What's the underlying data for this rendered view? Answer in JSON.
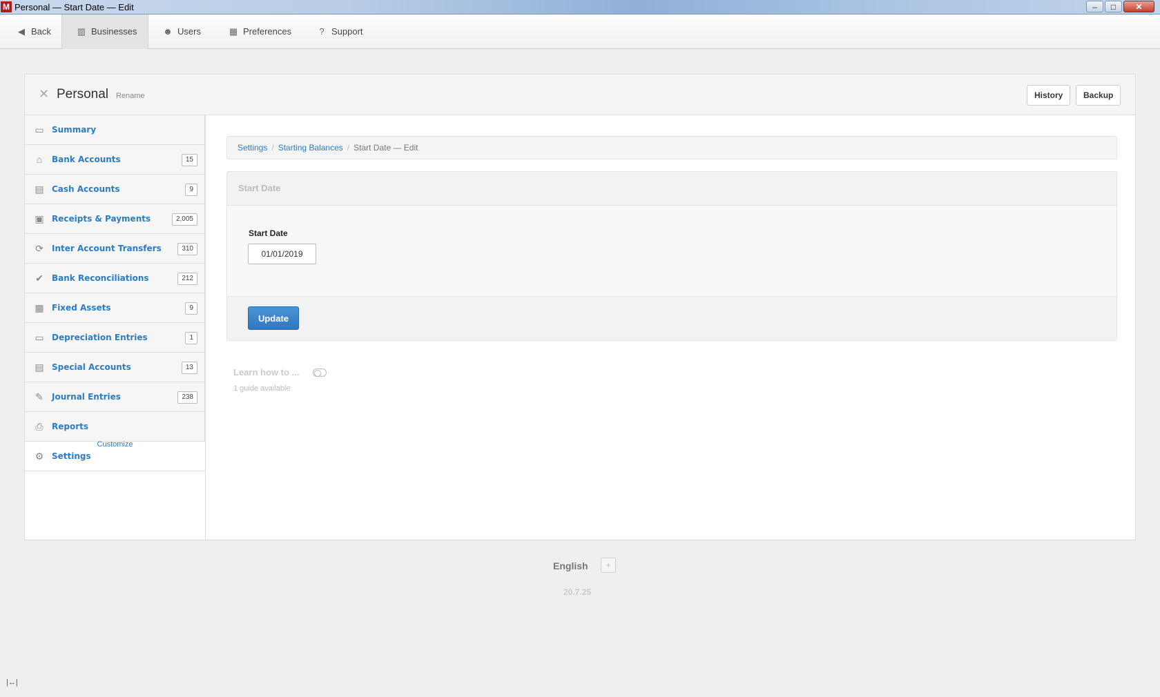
{
  "window": {
    "app_icon": "M",
    "title": "Personal — Start Date — Edit",
    "minimize": "–",
    "maximize": "□",
    "close": "✕"
  },
  "topnav": {
    "back": "Back",
    "businesses": "Businesses",
    "users": "Users",
    "preferences": "Preferences",
    "support": "Support"
  },
  "business": {
    "close": "✕",
    "name": "Personal",
    "rename": "Rename",
    "history": "History",
    "backup": "Backup"
  },
  "sidebar": {
    "items": [
      {
        "label": "Summary",
        "icon": "presentation-icon",
        "count": null
      },
      {
        "label": "Bank Accounts",
        "icon": "bank-icon",
        "count": "15"
      },
      {
        "label": "Cash Accounts",
        "icon": "cash-register-icon",
        "count": "9"
      },
      {
        "label": "Receipts & Payments",
        "icon": "receipt-icon",
        "count": "2,005"
      },
      {
        "label": "Inter Account Transfers",
        "icon": "transfer-icon",
        "count": "310"
      },
      {
        "label": "Bank Reconciliations",
        "icon": "checkmark-icon",
        "count": "212"
      },
      {
        "label": "Fixed Assets",
        "icon": "building-icon",
        "count": "9"
      },
      {
        "label": "Depreciation Entries",
        "icon": "battery-icon",
        "count": "1"
      },
      {
        "label": "Special Accounts",
        "icon": "book-icon",
        "count": "13"
      },
      {
        "label": "Journal Entries",
        "icon": "quill-icon",
        "count": "238"
      },
      {
        "label": "Reports",
        "icon": "printer-icon",
        "count": null
      },
      {
        "label": "Settings",
        "icon": "gears-icon",
        "count": null
      }
    ],
    "customize": "Customize"
  },
  "breadcrumb": {
    "settings": "Settings",
    "starting_balances": "Starting Balances",
    "current": "Start Date — Edit"
  },
  "form": {
    "title": "Start Date",
    "field_label": "Start Date",
    "start_date_value": "01/01/2019",
    "update_button": "Update"
  },
  "learn": {
    "title": "Learn how to ...",
    "subtitle": "1 guide available"
  },
  "footer": {
    "language": "English",
    "add": "+",
    "version": "20.7.25"
  },
  "colors": {
    "link": "#2d7cc1",
    "primary_button": "#3a85cb",
    "background": "#efefef"
  }
}
